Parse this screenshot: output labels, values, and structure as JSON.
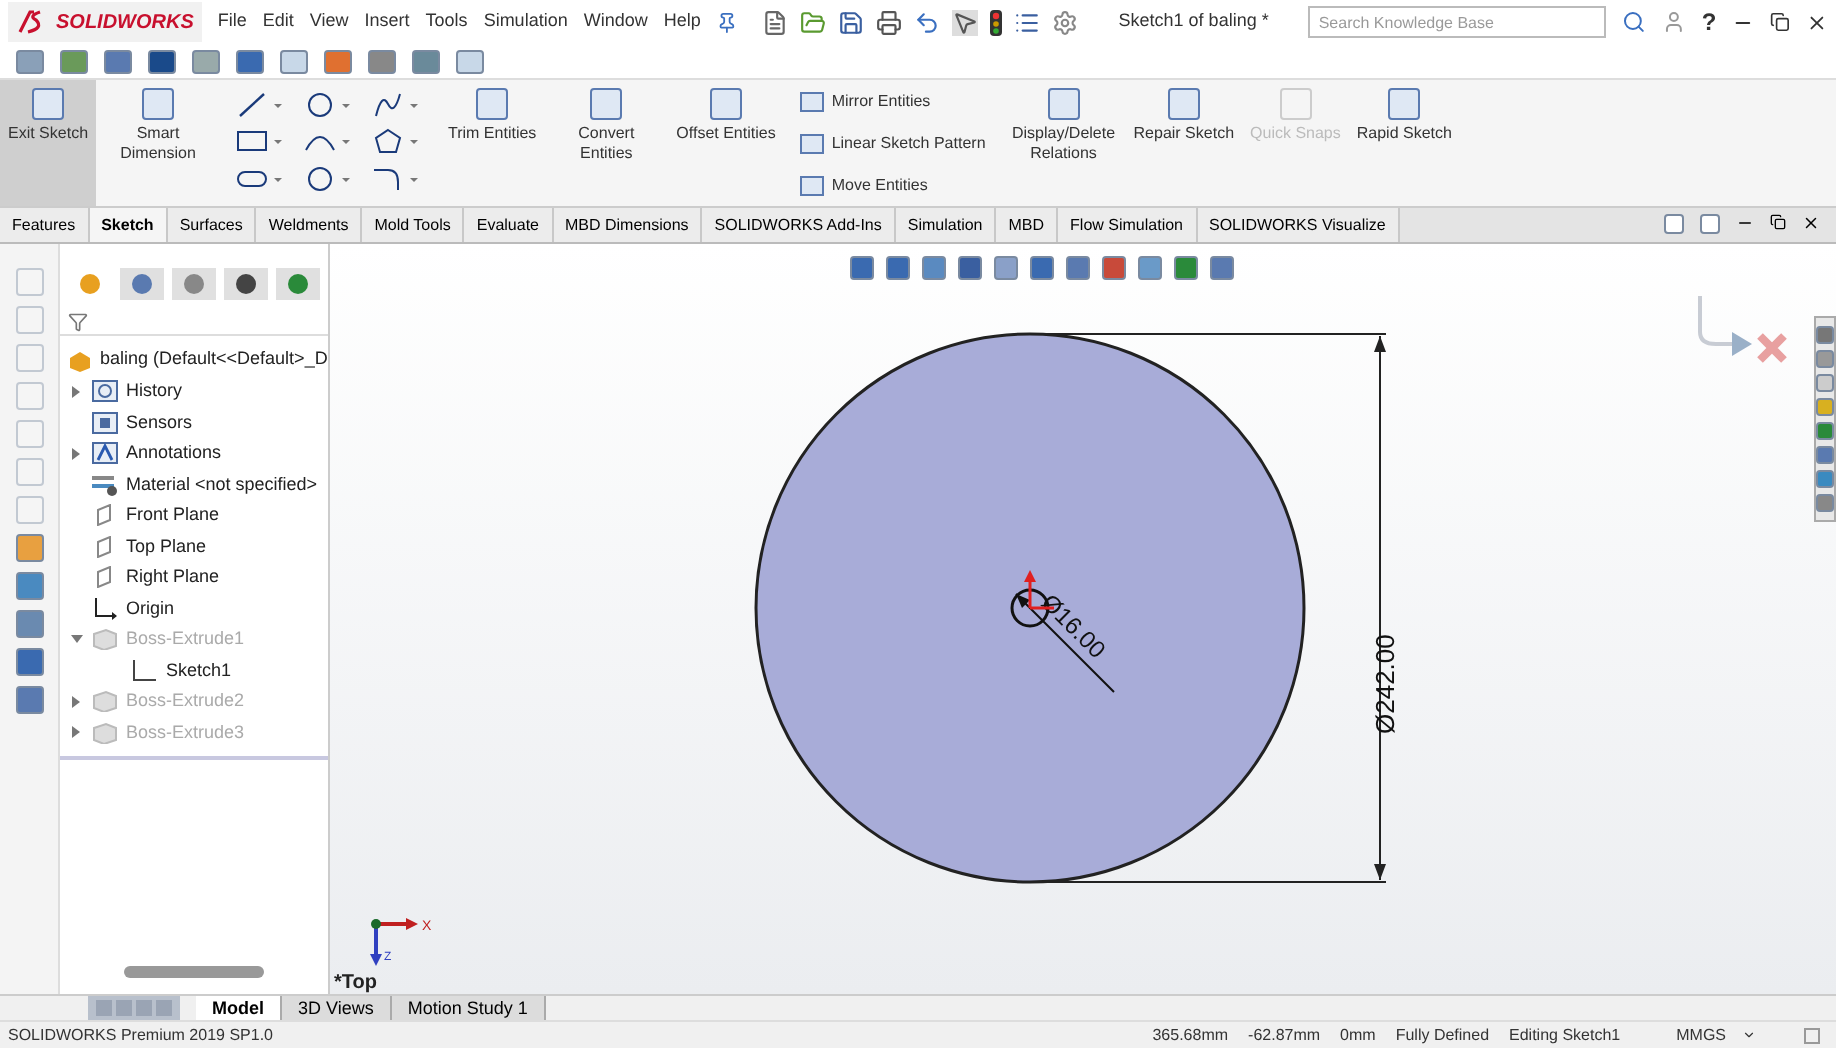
{
  "app": {
    "logo": "SOLIDWORKS",
    "menu": [
      "File",
      "Edit",
      "View",
      "Insert",
      "Tools",
      "Simulation",
      "Window",
      "Help"
    ],
    "document_title": "Sketch1 of baling *",
    "search": {
      "placeholder": "Search Knowledge Base"
    },
    "help": "?"
  },
  "ribbon": [
    {
      "kind": "large",
      "label": "Exit Sketch",
      "pressed": true,
      "disabled": false
    },
    {
      "kind": "large",
      "label": "Smart Dimension",
      "pressed": false,
      "disabled": false
    },
    {
      "kind": "sketch_tools"
    },
    {
      "kind": "large",
      "label": "Trim Entities",
      "pressed": false,
      "disabled": false
    },
    {
      "kind": "large",
      "label": "Convert Entities",
      "pressed": false,
      "disabled": false
    },
    {
      "kind": "large",
      "label": "Offset Entities",
      "pressed": false,
      "disabled": false
    },
    {
      "kind": "list",
      "items": [
        "Mirror Entities",
        "Linear Sketch Pattern",
        "Move Entities"
      ]
    },
    {
      "kind": "large",
      "label": "Display/Delete Relations",
      "pressed": false,
      "disabled": false
    },
    {
      "kind": "large",
      "label": "Repair Sketch",
      "pressed": false,
      "disabled": false
    },
    {
      "kind": "large",
      "label": "Quick Snaps",
      "pressed": false,
      "disabled": true
    },
    {
      "kind": "large",
      "label": "Rapid Sketch",
      "pressed": false,
      "disabled": false
    }
  ],
  "tabs": [
    {
      "label": "Features",
      "selected": false
    },
    {
      "label": "Sketch",
      "selected": true
    },
    {
      "label": "Surfaces",
      "selected": false
    },
    {
      "label": "Weldments",
      "selected": false
    },
    {
      "label": "Mold Tools",
      "selected": false
    },
    {
      "label": "Evaluate",
      "selected": false
    },
    {
      "label": "MBD Dimensions",
      "selected": false
    },
    {
      "label": "SOLIDWORKS Add-Ins",
      "selected": false
    },
    {
      "label": "Simulation",
      "selected": false
    },
    {
      "label": "MBD",
      "selected": false
    },
    {
      "label": "Flow Simulation",
      "selected": false
    },
    {
      "label": "SOLIDWORKS Visualize",
      "selected": false
    }
  ],
  "panel_tabs": [
    {
      "selected": true
    },
    {
      "selected": false
    },
    {
      "selected": false
    },
    {
      "selected": false
    },
    {
      "selected": false
    }
  ],
  "feature_tree": {
    "root": "baling  (Default<<Default>_D",
    "nodes": [
      {
        "label": "History",
        "kind": "history",
        "expandable": true,
        "expanded": false,
        "dimmed": false
      },
      {
        "label": "Sensors",
        "kind": "sensors",
        "expandable": false,
        "dimmed": false
      },
      {
        "label": "Annotations",
        "kind": "annotations",
        "expandable": true,
        "expanded": false,
        "dimmed": false
      },
      {
        "label": "Material <not specified>",
        "kind": "material",
        "expandable": false,
        "dimmed": false
      },
      {
        "label": "Front Plane",
        "kind": "plane",
        "expandable": false,
        "dimmed": false
      },
      {
        "label": "Top Plane",
        "kind": "plane",
        "expandable": false,
        "dimmed": false
      },
      {
        "label": "Right Plane",
        "kind": "plane",
        "expandable": false,
        "dimmed": false
      },
      {
        "label": "Origin",
        "kind": "origin",
        "expandable": false,
        "dimmed": false
      },
      {
        "label": "Boss-Extrude1",
        "kind": "feature",
        "expandable": true,
        "expanded": true,
        "dimmed": true,
        "children": [
          {
            "label": "Sketch1",
            "kind": "sketch",
            "expandable": false,
            "dimmed": false
          }
        ]
      },
      {
        "label": "Boss-Extrude2",
        "kind": "feature",
        "expandable": true,
        "expanded": false,
        "dimmed": true
      },
      {
        "label": "Boss-Extrude3",
        "kind": "feature",
        "expandable": true,
        "expanded": false,
        "dimmed": true
      }
    ]
  },
  "canvas": {
    "outer_diameter": "Ø242.00",
    "hole_diameter": "Ø16.00",
    "view_label": "*Top",
    "axis_labels": [
      "X",
      "Z"
    ]
  },
  "bottom_tabs": [
    {
      "label": "Model",
      "selected": true
    },
    {
      "label": "3D Views",
      "selected": false
    },
    {
      "label": "Motion Study 1",
      "selected": false
    }
  ],
  "status_bar": {
    "product": "SOLIDWORKS Premium 2019 SP1.0",
    "fields": [
      "365.68mm",
      "-62.87mm",
      "0mm",
      "Fully Defined",
      "Editing Sketch1"
    ],
    "units": "MMGS"
  }
}
